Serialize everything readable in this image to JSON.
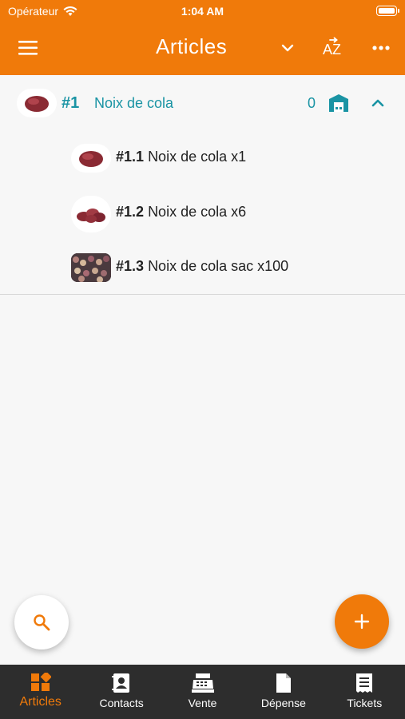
{
  "status": {
    "carrier": "Opérateur",
    "time": "1:04 AM"
  },
  "header": {
    "title": "Articles",
    "menu_icon": "menu-icon",
    "dropdown_icon": "chevron-down-icon",
    "sort_label": "AZ",
    "more_icon": "more-icon"
  },
  "group": {
    "number": "#1",
    "name": "Noix de cola",
    "count": "0",
    "store_icon": "store-icon",
    "collapse_icon": "chevron-up-icon"
  },
  "items": [
    {
      "number": "#1.1",
      "name": "Noix de cola x1"
    },
    {
      "number": "#1.2",
      "name": "Noix de cola x6"
    },
    {
      "number": "#1.3",
      "name": "Noix de cola sac x100"
    }
  ],
  "fabs": {
    "search_icon": "search-icon",
    "add_icon": "plus-icon"
  },
  "tabs": [
    {
      "label": "Articles",
      "icon": "grid-icon",
      "active": true
    },
    {
      "label": "Contacts",
      "icon": "contacts-icon",
      "active": false
    },
    {
      "label": "Vente",
      "icon": "cash-register-icon",
      "active": false
    },
    {
      "label": "Dépense",
      "icon": "document-icon",
      "active": false
    },
    {
      "label": "Tickets",
      "icon": "receipt-icon",
      "active": false
    }
  ],
  "colors": {
    "accent": "#f07a0a",
    "teal": "#1a94a4",
    "tabbar": "#2d2d2d"
  }
}
